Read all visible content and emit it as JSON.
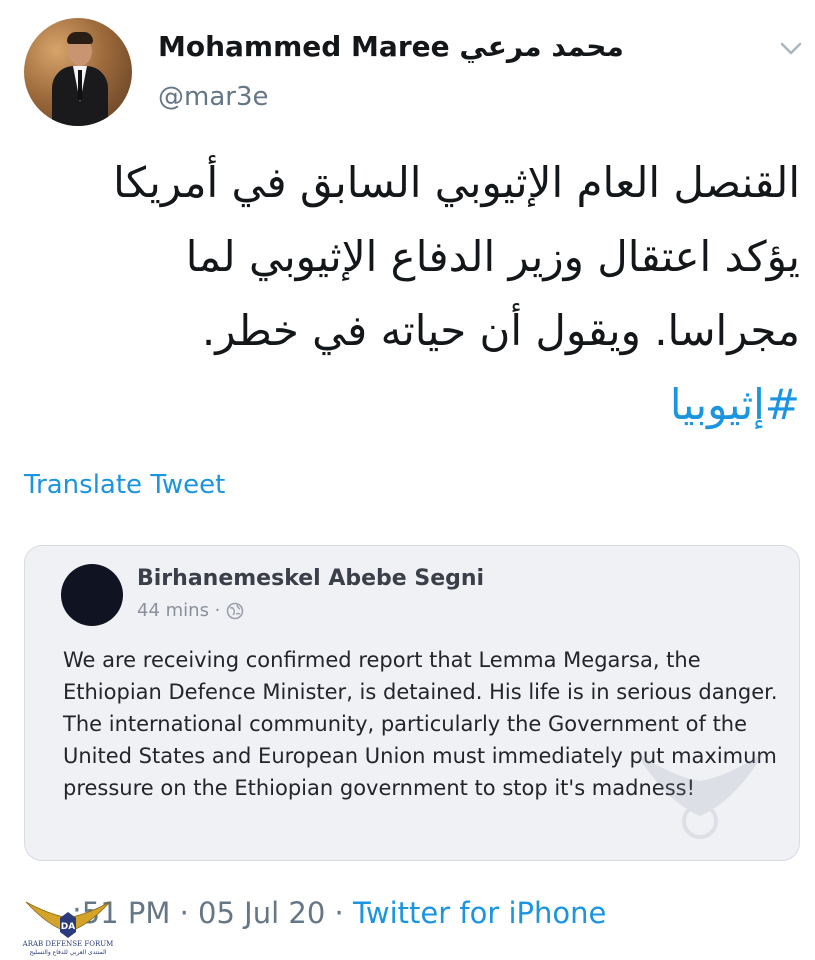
{
  "tweet": {
    "display_name": "Mohammed Maree محمد مرعي",
    "handle": "@mar3e",
    "text_lines": [
      "القنصل العام الإثيوبي السابق في أمريكا",
      "يؤكد اعتقال وزير الدفاع الإثيوبي لما",
      "مجراسا. ويقول أن حياته في خطر."
    ],
    "hashtag": "#إثيوبيا",
    "translate_label": "Translate Tweet",
    "timestamp": ":51 PM · 05 Jul 20",
    "separator": " · ",
    "source": "Twitter for iPhone"
  },
  "embedded_post": {
    "author": "Birhanemeskel Abebe Segni",
    "time": "44 mins ·",
    "body": "We are receiving confirmed report that Lemma Megarsa, the Ethiopian Defence Minister, is detained. His life is in serious danger. The international community, particularly the Government of the United States and European Union must immediately put maximum pressure on the Ethiopian government to stop it's madness!"
  },
  "watermark_logo": {
    "title": "ARAB DEFENSE FORUM",
    "subtitle": "المنتدى العربي للدفاع والتسليح",
    "mark": "DA"
  },
  "icons": {
    "menu": "chevron-down-icon",
    "visibility": "globe-icon"
  },
  "colors": {
    "link": "#1b95e0",
    "secondary_text": "#657786",
    "card_background": "#f0f1f4"
  }
}
